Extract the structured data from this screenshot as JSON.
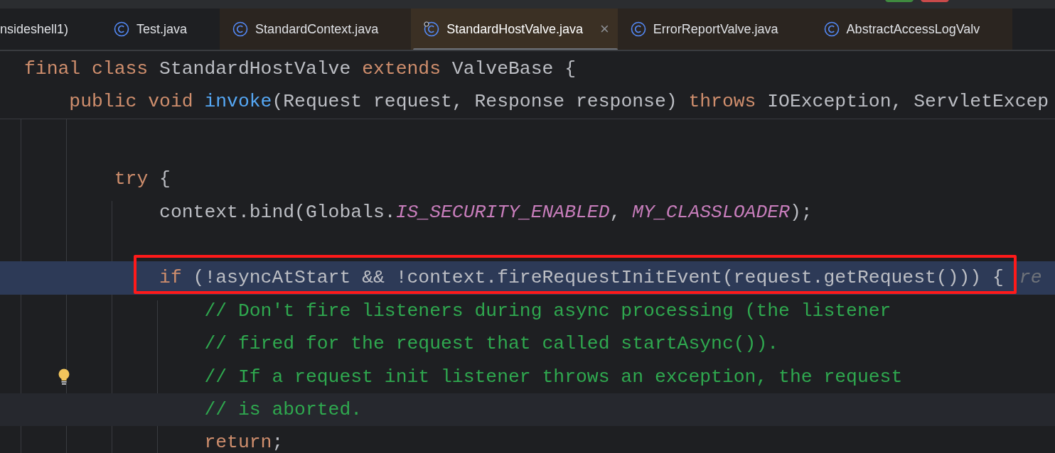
{
  "tabs": [
    {
      "label": "nsideshell1)",
      "icon": false,
      "selected": false,
      "color": "#1e1f22",
      "closable": false
    },
    {
      "label": "Test.java",
      "icon": true,
      "selected": false,
      "color": "#1e1f22",
      "closable": false
    },
    {
      "label": "StandardContext.java",
      "icon": true,
      "selected": false,
      "color": "#2b2520",
      "closable": false
    },
    {
      "label": "StandardHostValve.java",
      "icon": true,
      "selected": true,
      "color": "#3b3024",
      "closable": true,
      "close_label": "×"
    },
    {
      "label": "ErrorReportValve.java",
      "icon": true,
      "selected": false,
      "color": "#2b2520",
      "closable": false
    },
    {
      "label": "AbstractAccessLogValv",
      "icon": true,
      "selected": false,
      "color": "#2b2520",
      "closable": false
    }
  ],
  "sticky_header": [
    {
      "kind": "code",
      "tokens": [
        {
          "kind": "keyword",
          "text": "final class"
        },
        {
          "kind": "plain",
          "text": " StandardHostValve "
        },
        {
          "kind": "keyword",
          "text": "extends"
        },
        {
          "kind": "plain",
          "text": " ValveBase {"
        }
      ]
    },
    {
      "kind": "code",
      "tokens": [
        {
          "kind": "keyword",
          "text": "    public void "
        },
        {
          "kind": "method",
          "text": "invoke"
        },
        {
          "kind": "plain",
          "text": "(Request request, Response response) "
        },
        {
          "kind": "keyword",
          "text": "throws"
        },
        {
          "kind": "plain",
          "text": " IOException, ServletExcep"
        }
      ]
    }
  ],
  "lines": [
    {
      "kind": "blank"
    },
    {
      "kind": "code",
      "current": false,
      "highlighted": false,
      "boxed": false,
      "bulb": false,
      "tokens": [
        {
          "kind": "keyword",
          "text": "        try"
        },
        {
          "kind": "plain",
          "text": " {"
        }
      ]
    },
    {
      "kind": "code",
      "current": false,
      "highlighted": false,
      "boxed": false,
      "bulb": false,
      "tokens": [
        {
          "kind": "plain",
          "text": "            context.bind(Globals."
        },
        {
          "kind": "field",
          "text": "IS_SECURITY_ENABLED"
        },
        {
          "kind": "plain",
          "text": ", "
        },
        {
          "kind": "field",
          "text": "MY_CLASSLOADER"
        },
        {
          "kind": "plain",
          "text": ");"
        }
      ]
    },
    {
      "kind": "blank"
    },
    {
      "kind": "code",
      "current": false,
      "highlighted": true,
      "boxed": true,
      "bulb": false,
      "tokens": [
        {
          "kind": "keyword",
          "text": "            if"
        },
        {
          "kind": "plain",
          "text": " (!asyncAtStart && !context.fireRequestInitEvent(request.getRequest())) {"
        },
        {
          "kind": "hint",
          "text": "re"
        }
      ]
    },
    {
      "kind": "code",
      "current": false,
      "highlighted": false,
      "boxed": false,
      "bulb": false,
      "tokens": [
        {
          "kind": "comment",
          "text": "                // Don't fire listeners during async processing (the listener"
        }
      ]
    },
    {
      "kind": "code",
      "current": false,
      "highlighted": false,
      "boxed": false,
      "bulb": false,
      "tokens": [
        {
          "kind": "comment",
          "text": "                // fired for the request that called startAsync())."
        }
      ]
    },
    {
      "kind": "code",
      "current": false,
      "highlighted": false,
      "boxed": false,
      "bulb": true,
      "tokens": [
        {
          "kind": "comment",
          "text": "                // If a request init listener throws an exception, the request"
        }
      ]
    },
    {
      "kind": "code",
      "current": true,
      "highlighted": false,
      "boxed": false,
      "bulb": false,
      "tokens": [
        {
          "kind": "comment",
          "text": "                // is aborted."
        }
      ]
    },
    {
      "kind": "code",
      "current": false,
      "highlighted": false,
      "boxed": false,
      "bulb": false,
      "tokens": [
        {
          "kind": "keyword",
          "text": "                return"
        },
        {
          "kind": "plain",
          "text": ";"
        }
      ]
    }
  ]
}
